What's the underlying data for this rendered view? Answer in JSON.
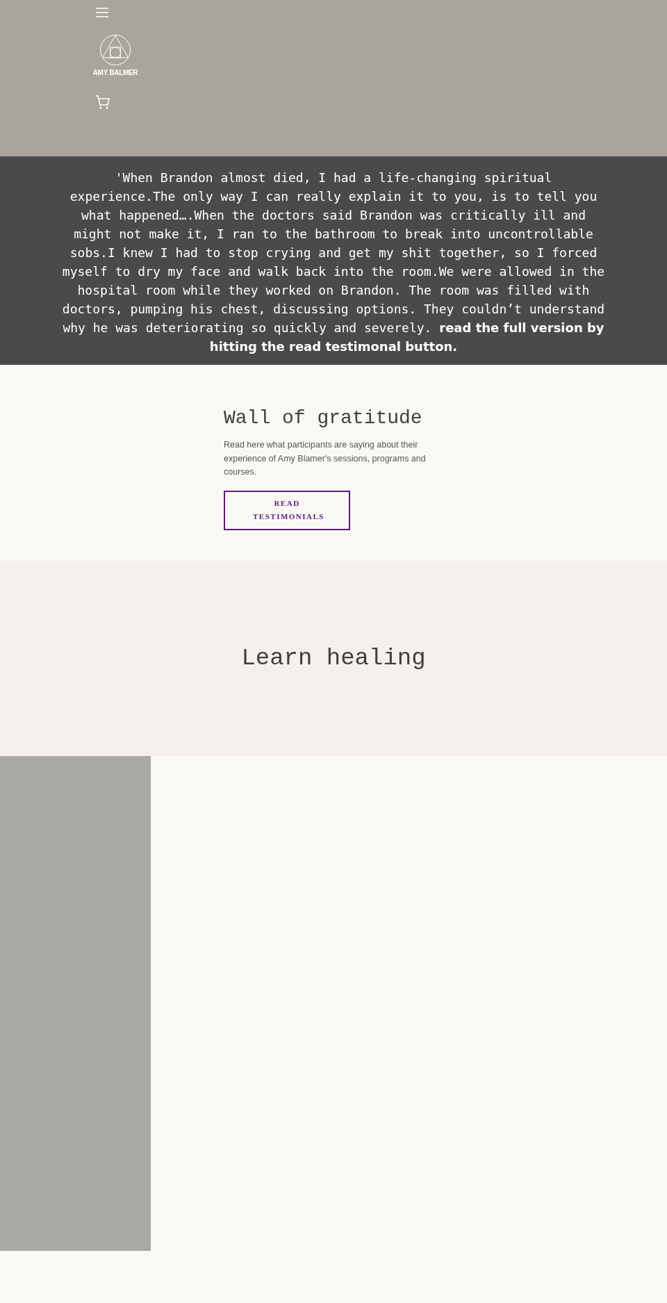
{
  "header": {
    "logo_text": "AMY BALMER"
  },
  "quote": {
    "text": "'When Brandon almost died, I had a life-changing spiritual experience.The only way I can really explain it to you, is to tell you what happened….When the doctors said Brandon was critically ill and might not make it, I ran to the bathroom to break into uncontrollable sobs.I knew I had to stop crying and get my shit together, so I forced myself to dry my face and walk back into the room.We were allowed in the hospital room while they worked on Brandon. The room was filled with doctors, pumping his chest, discussing options. They couldn’t understand why he was deteriorating so quickly and severely. **read the full version by hitting the read testimonal button.**"
  },
  "gratitude": {
    "title": "Wall of gratitude",
    "body": "Read here what participants are saying about their experience of  Amy Blamer's sessions, programs and courses.",
    "button": "READ TESTIMONIALS"
  },
  "learn": {
    "title": "Learn healing"
  }
}
